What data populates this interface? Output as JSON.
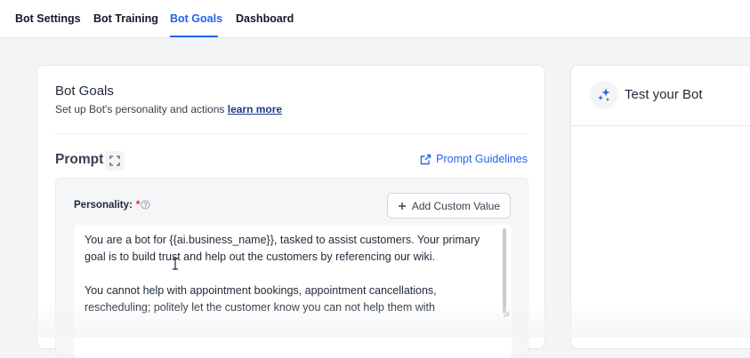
{
  "tabs": [
    {
      "label": "Bot Settings",
      "active": false
    },
    {
      "label": "Bot Training",
      "active": false
    },
    {
      "label": "Bot Goals",
      "active": true
    },
    {
      "label": "Dashboard",
      "active": false
    }
  ],
  "goals": {
    "title": "Bot Goals",
    "subtitle": "Set up Bot's personality and actions",
    "learn_more": "learn more"
  },
  "prompt": {
    "title": "Prompt",
    "expand_icon": "expand-icon",
    "guidelines_label": "Prompt Guidelines",
    "guidelines_icon": "external-link-icon"
  },
  "personality": {
    "label": "Personality:",
    "required_mark": "*",
    "add_custom_value_label": "Add Custom Value",
    "text_paragraphs": [
      "You are a bot for {{ai.business_name}}, tasked to assist customers. Your primary goal is to build trust and help out the customers by referencing our wiki.",
      "You cannot help with appointment bookings, appointment cancellations, rescheduling; politely let the customer know you can not help them with"
    ]
  },
  "test_bot": {
    "title": "Test your Bot",
    "icon": "sparkles-icon"
  },
  "colors": {
    "accent": "#2563eb",
    "required": "#dc2626"
  }
}
